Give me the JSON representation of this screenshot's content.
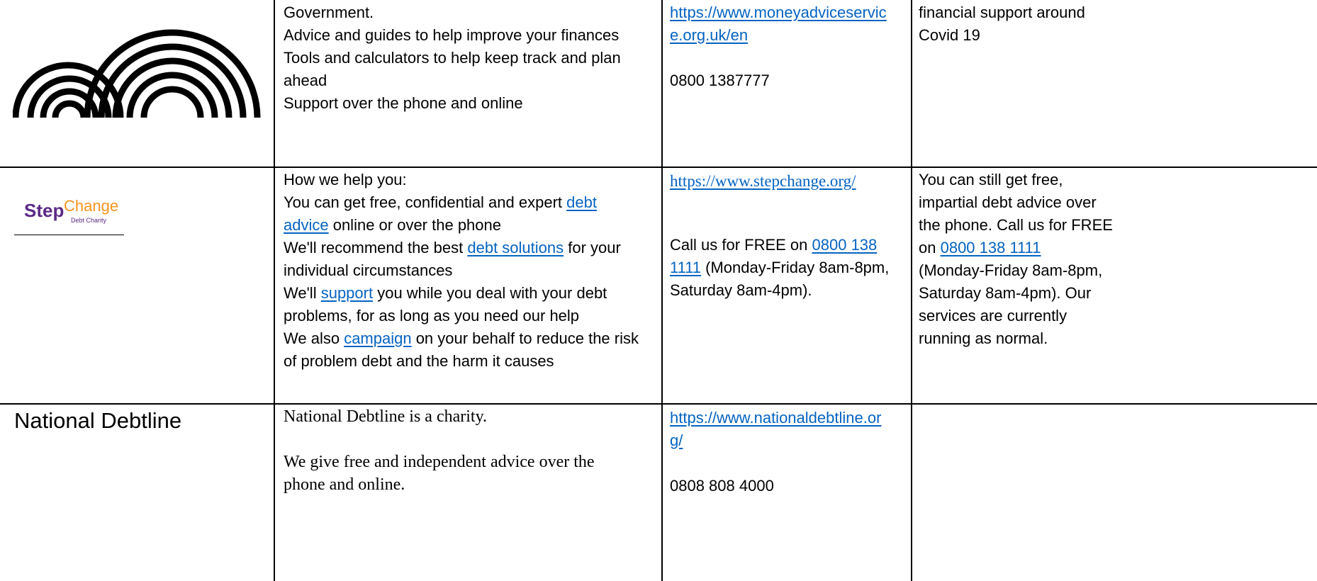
{
  "rows": [
    {
      "description": [
        "Government.",
        "Advice and guides to help improve your finances",
        "Tools and calculators to help keep track and plan",
        "ahead",
        "Support over the phone and online"
      ],
      "website_lines": [
        "https://www.moneyadviceservic",
        "e.org.uk/en"
      ],
      "phone": "0800 1387777",
      "covid_note": [
        "financial support around",
        "Covid 19"
      ]
    },
    {
      "logo_text": {
        "main": "Step",
        "accent": "Change",
        "tagline": "Debt Charity"
      },
      "description": {
        "l1": "How we help you:",
        "l2a": "You can get free, confidential and expert ",
        "l2link": "debt",
        "l3link": "advice",
        "l3b": " online or over the phone",
        "l4a": "We'll recommend the best ",
        "l4link": "debt solutions",
        "l4b": " for your",
        "l5": "individual circumstances",
        "l6a": "We'll ",
        "l6link": "support",
        "l6b": " you while you deal with your debt",
        "l7": "problems, for as long as you need our help",
        "l8a": "We also ",
        "l8link": "campaign",
        "l8b": " on your behalf to reduce the risk",
        "l9": "of problem debt and the harm it causes"
      },
      "website": "https://www.stepchange.org/",
      "phone": {
        "l1a": "Call us for FREE on ",
        "l1link": "0800 138",
        "l2link": "1111",
        "l2b": " (Monday-Friday 8am-8pm,",
        "l3": "Saturday 8am-4pm)."
      },
      "covid_note": {
        "l1": "You can still get free,",
        "l2": "impartial debt advice over",
        "l3": "the phone. Call us for FREE",
        "l4a": "on ",
        "l4link": "0800 138 1111",
        "l5": "(Monday-Friday 8am-8pm,",
        "l6": "Saturday 8am-4pm). Our",
        "l7": "services are currently",
        "l8": "running as normal."
      }
    },
    {
      "org_name": "National Debtline",
      "description": [
        "National Debtline is a charity.",
        "We give free and independent advice over the",
        "phone and online."
      ],
      "website_lines": [
        "https://www.nationaldebtline.or",
        "g/"
      ],
      "phone": "0808 808 4000"
    }
  ],
  "colors": {
    "link": "#0563c1",
    "stepchange_purple": "#5b2a86",
    "stepchange_orange": "#f7941d"
  }
}
